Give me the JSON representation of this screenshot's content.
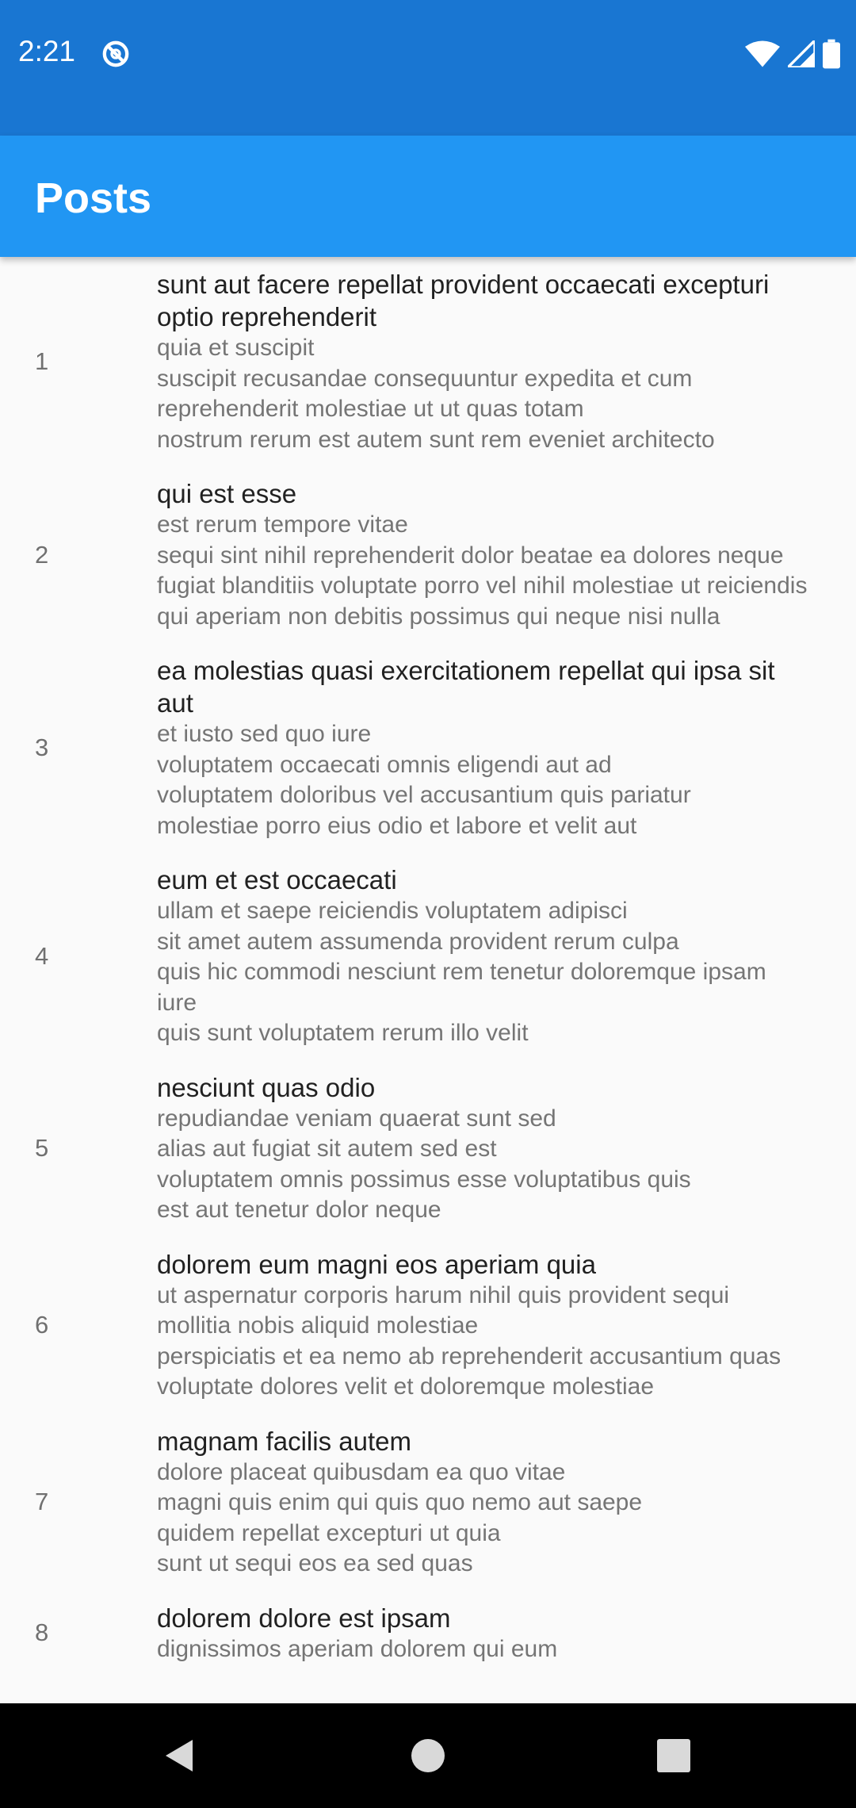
{
  "status_bar": {
    "time": "2:21",
    "icons": [
      "sync-disabled-icon",
      "wifi-icon",
      "cellular-icon",
      "battery-icon"
    ]
  },
  "app_bar": {
    "title": "Posts"
  },
  "posts": [
    {
      "id": "1",
      "title": "sunt aut facere repellat provident occaecati excepturi optio reprehenderit",
      "body": "quia et suscipit\nsuscipit recusandae consequuntur expedita et cum reprehenderit molestiae ut ut quas totam\nnostrum rerum est autem sunt rem eveniet architecto"
    },
    {
      "id": "2",
      "title": "qui est esse",
      "body": "est rerum tempore vitae\nsequi sint nihil reprehenderit dolor beatae ea dolores neque\nfugiat blanditiis voluptate porro vel nihil molestiae ut reiciendis\nqui aperiam non debitis possimus qui neque nisi nulla"
    },
    {
      "id": "3",
      "title": "ea molestias quasi exercitationem repellat qui ipsa sit aut",
      "body": "et iusto sed quo iure\nvoluptatem occaecati omnis eligendi aut ad\nvoluptatem doloribus vel accusantium quis pariatur\nmolestiae porro eius odio et labore et velit aut"
    },
    {
      "id": "4",
      "title": "eum et est occaecati",
      "body": "ullam et saepe reiciendis voluptatem adipisci\nsit amet autem assumenda provident rerum culpa\nquis hic commodi nesciunt rem tenetur doloremque ipsam iure\nquis sunt voluptatem rerum illo velit"
    },
    {
      "id": "5",
      "title": "nesciunt quas odio",
      "body": "repudiandae veniam quaerat sunt sed\nalias aut fugiat sit autem sed est\nvoluptatem omnis possimus esse voluptatibus quis\nest aut tenetur dolor neque"
    },
    {
      "id": "6",
      "title": "dolorem eum magni eos aperiam quia",
      "body": "ut aspernatur corporis harum nihil quis provident sequi\nmollitia nobis aliquid molestiae\nperspiciatis et ea nemo ab reprehenderit accusantium quas\nvoluptate dolores velit et doloremque molestiae"
    },
    {
      "id": "7",
      "title": "magnam facilis autem",
      "body": "dolore placeat quibusdam ea quo vitae\nmagni quis enim qui quis quo nemo aut saepe\nquidem repellat excepturi ut quia\nsunt ut sequi eos ea sed quas"
    },
    {
      "id": "8",
      "title": "dolorem dolore est ipsam",
      "body": "dignissimos aperiam dolorem qui eum"
    }
  ],
  "nav_bar": {
    "icons": [
      "back-icon",
      "home-icon",
      "recents-icon"
    ]
  },
  "colors": {
    "status_bar": "#1976d2",
    "app_bar": "#2196f3",
    "background": "#fafafa"
  }
}
